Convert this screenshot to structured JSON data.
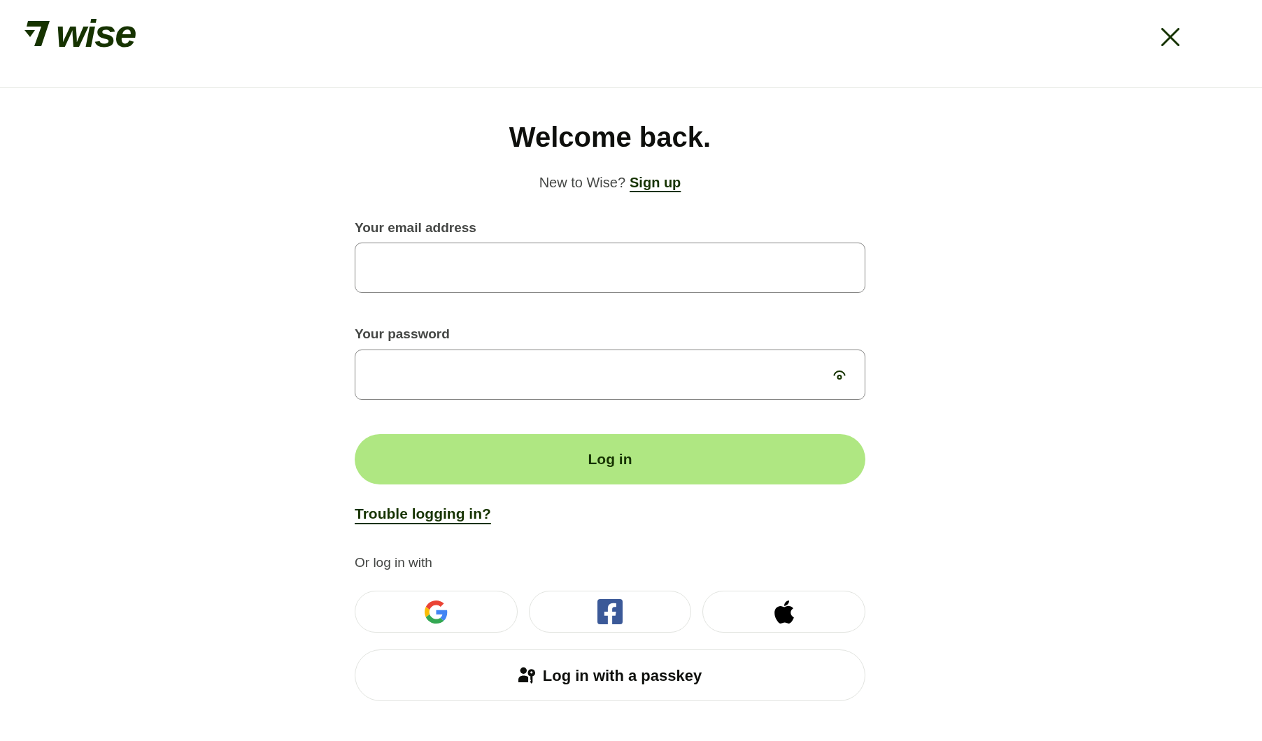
{
  "header": {
    "logo_text": "wise"
  },
  "form": {
    "title": "Welcome back.",
    "signup_prompt": "New to Wise?",
    "signup_link": "Sign up",
    "fields": [
      {
        "label": "Your email address",
        "kind": "email"
      },
      {
        "label": "Your password",
        "kind": "password"
      }
    ],
    "login_button": "Log in",
    "trouble_link": "Trouble logging in?",
    "alt_login_label": "Or log in with",
    "social_buttons": [
      {
        "kind": "google"
      },
      {
        "kind": "facebook"
      },
      {
        "kind": "apple"
      }
    ],
    "passkey_button": "Log in with a passkey"
  }
}
